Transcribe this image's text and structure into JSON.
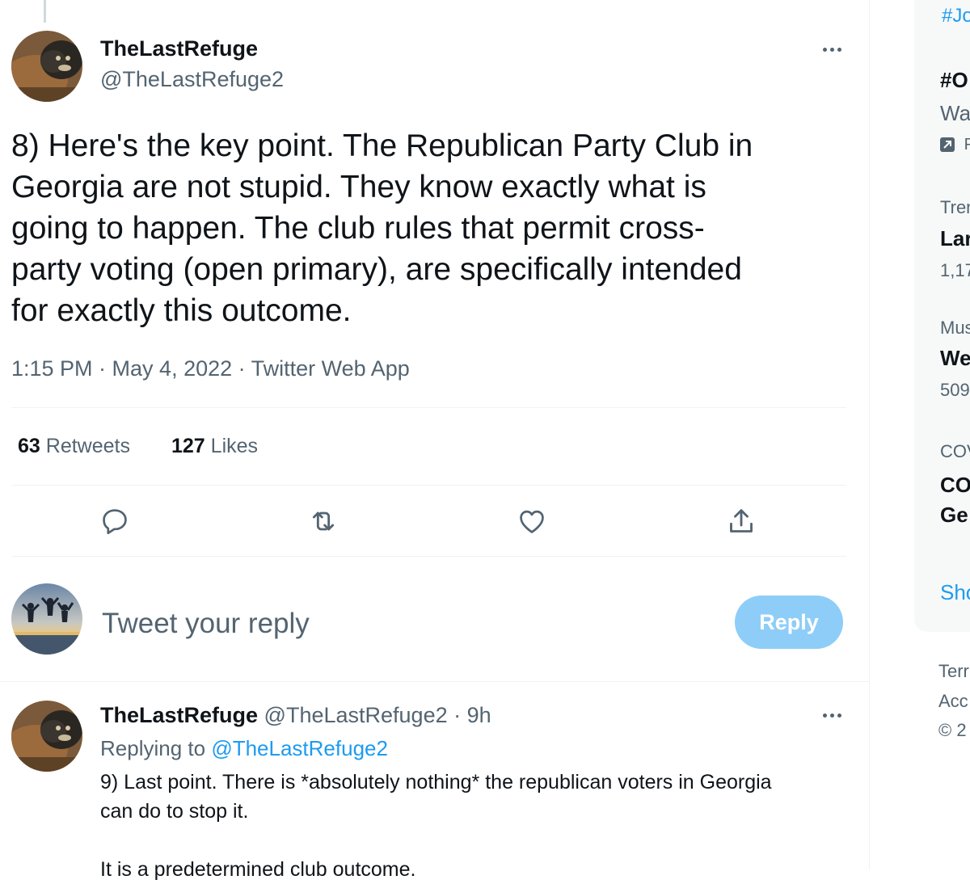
{
  "tweet": {
    "display_name": "TheLastRefuge",
    "handle": "@TheLastRefuge2",
    "text_lines": [
      "8) Here's the key point.  The Republican Party Club in",
      "Georgia are not stupid.  They know exactly what is",
      "going to happen.  The club rules that permit cross-",
      "party voting (open primary), are specifically intended",
      "for exactly this outcome."
    ],
    "meta": "1:15 PM · May 4, 2022 · Twitter Web App",
    "retweets_count": "63",
    "retweets_label": "Retweets",
    "likes_count": "127",
    "likes_label": "Likes"
  },
  "compose": {
    "placeholder": "Tweet your reply",
    "reply_label": "Reply"
  },
  "reply_tweet": {
    "display_name": "TheLastRefuge",
    "handle_time": "@TheLastRefuge2 · 9h",
    "replying_to_label": "Replying to",
    "replying_to_handle": "@TheLastRefuge2",
    "line1": "9) Last point.  There is *absolutely nothing* the republican voters in Georgia",
    "line2": "can do to stop it.",
    "line3": "It is a predetermined club outcome."
  },
  "sidebar": {
    "hashtag_top": "#Jo",
    "trend1_title": "#O",
    "trend1_sub": "Wa",
    "trend1_promo": "P",
    "trend2_context": "Tren",
    "trend2_title": "Lar",
    "trend2_count": "1,17",
    "trend3_context": "Mus",
    "trend3_title": "We",
    "trend3_count": "509",
    "trend4_context": "COV",
    "trend4_title_1": "CO",
    "trend4_title_2": "Ge",
    "show_more": "Sho",
    "footer_1": "Terr",
    "footer_2": "Acc",
    "footer_3": "© 2"
  },
  "colors": {
    "accent": "#1d9bf0",
    "reply_button_disabled": "#8ecdf8",
    "muted_text": "#536471",
    "divider": "#eff3f4"
  },
  "icons": [
    "more-icon",
    "reply-icon",
    "retweet-icon",
    "like-icon",
    "share-icon",
    "promoted-icon"
  ]
}
